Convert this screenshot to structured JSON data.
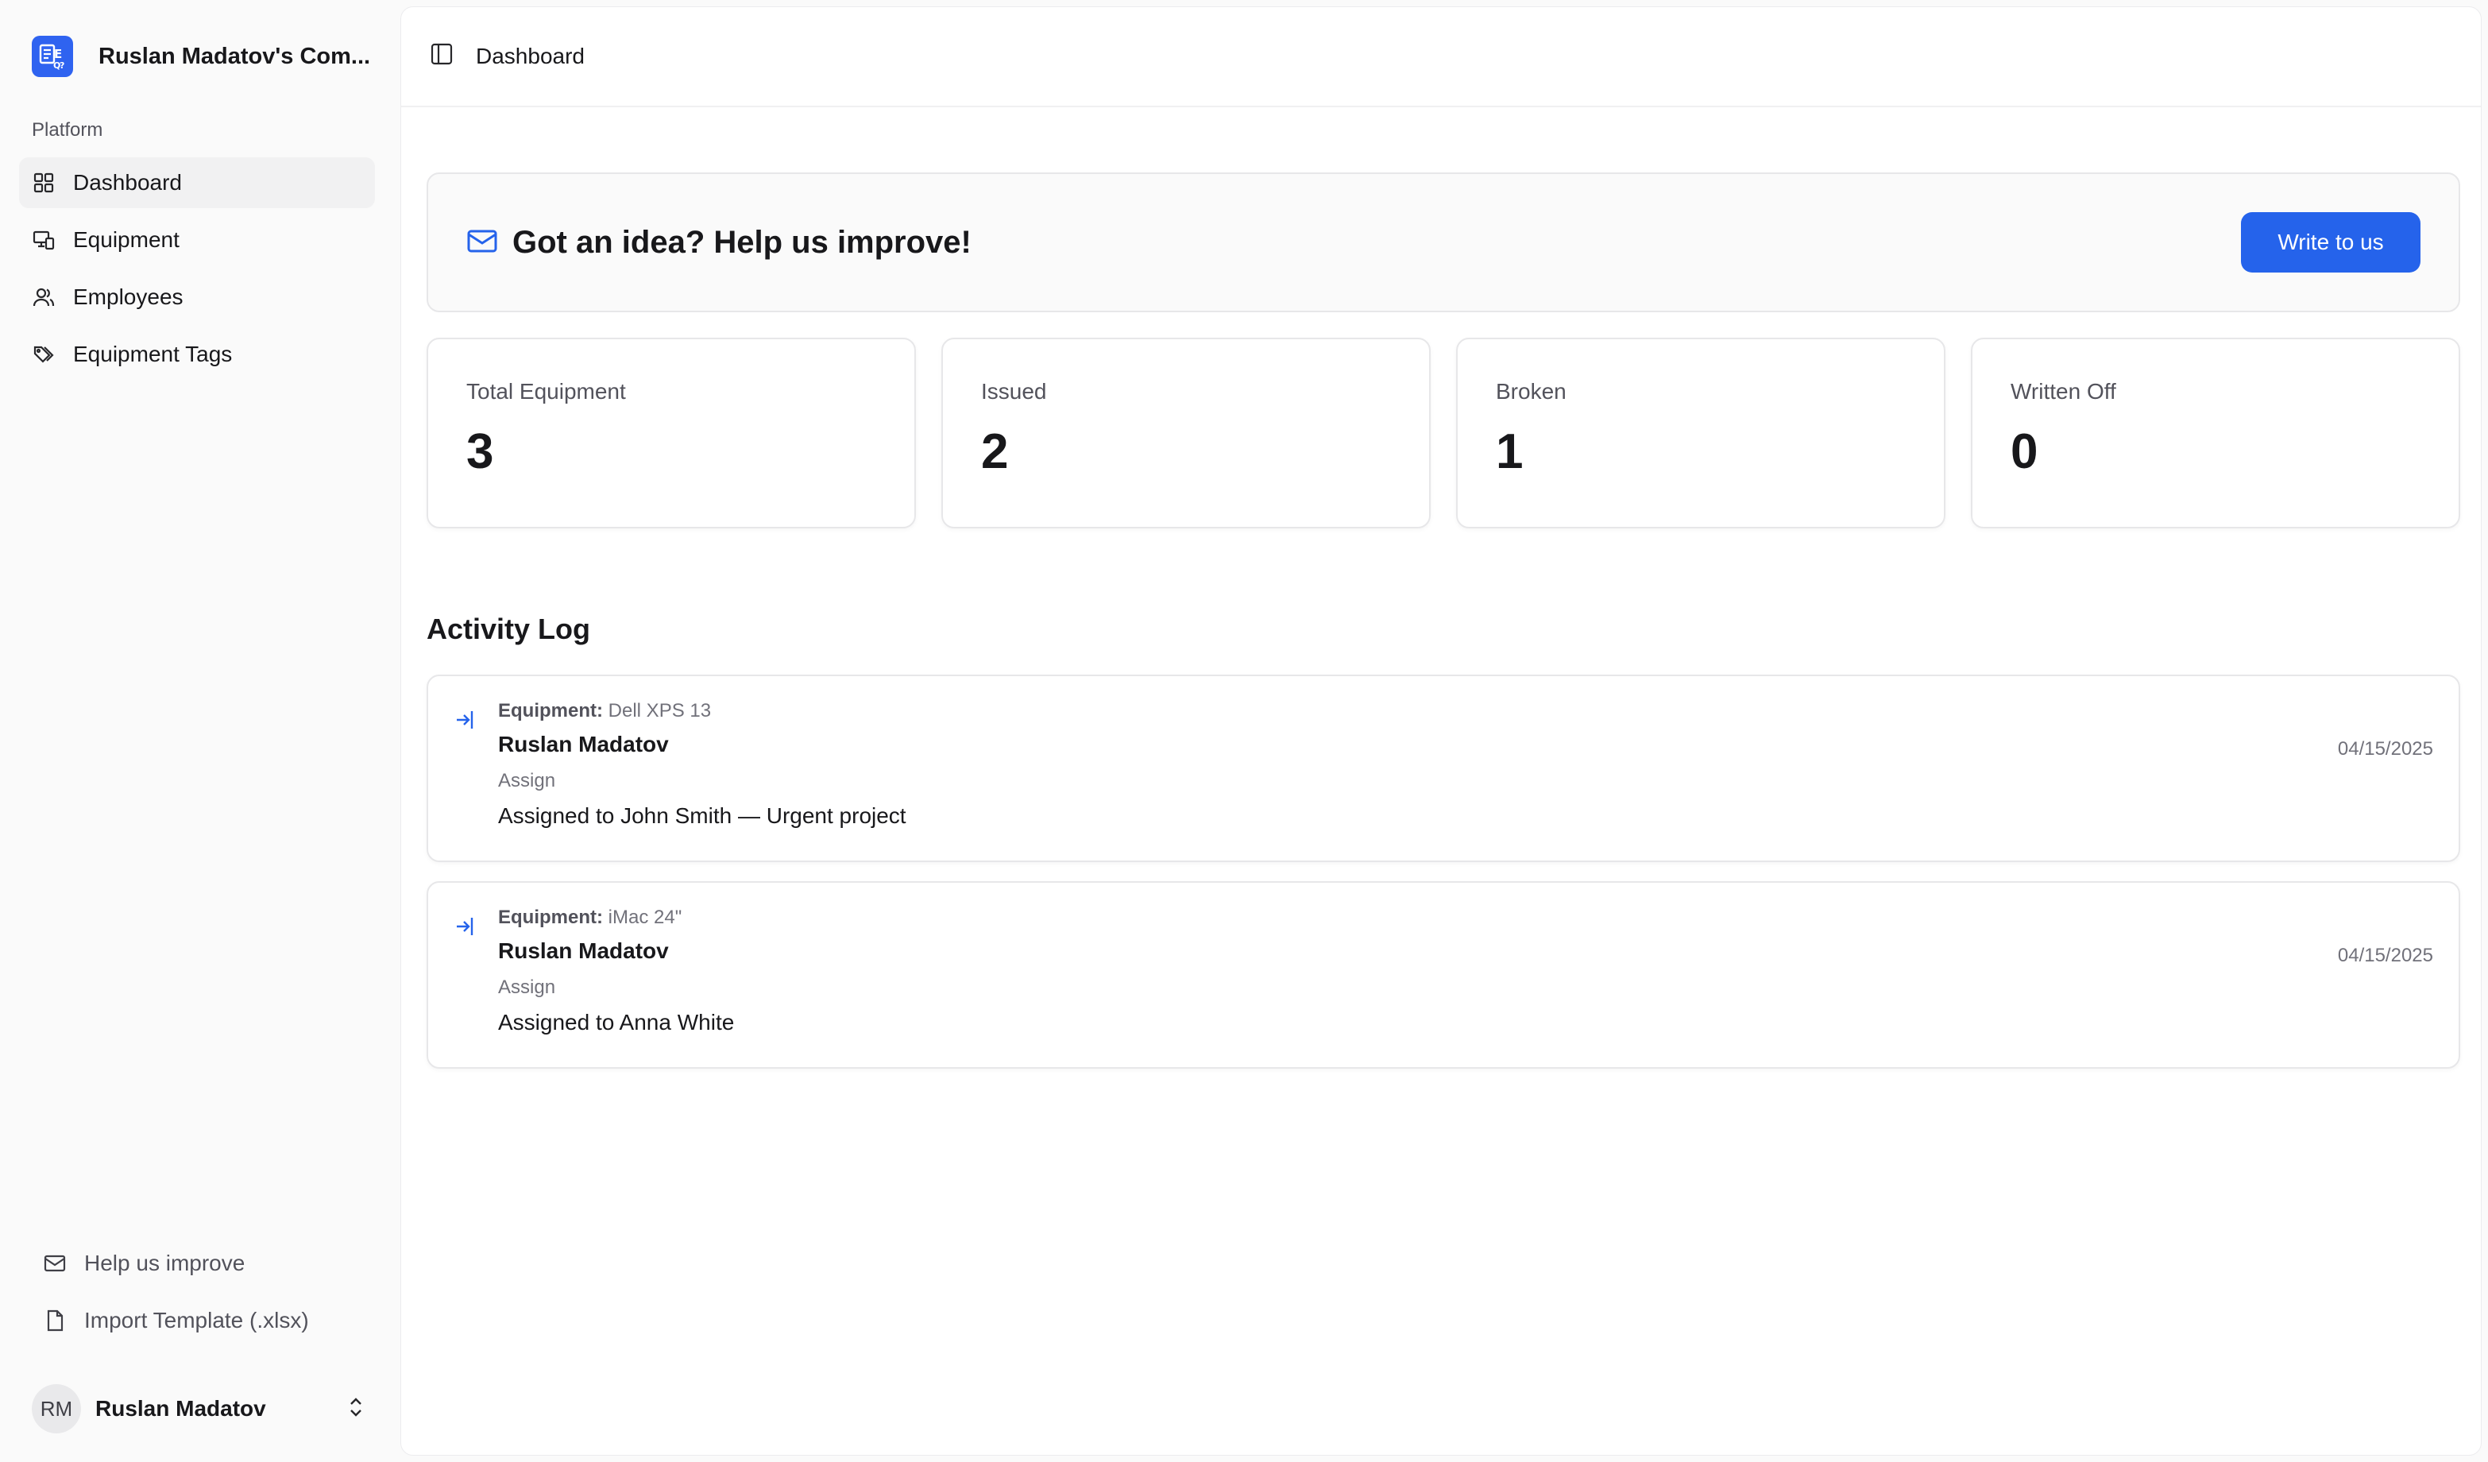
{
  "sidebar": {
    "company": "Ruslan Madatov's Com...",
    "section_label": "Platform",
    "items": [
      {
        "label": "Dashboard",
        "icon": "dashboard-icon"
      },
      {
        "label": "Equipment",
        "icon": "equipment-icon"
      },
      {
        "label": "Employees",
        "icon": "users-icon"
      },
      {
        "label": "Equipment Tags",
        "icon": "tags-icon"
      }
    ],
    "footer_links": [
      {
        "label": "Help us improve",
        "icon": "mail-icon"
      },
      {
        "label": "Import Template (.xlsx)",
        "icon": "file-icon"
      }
    ],
    "user": {
      "initials": "RM",
      "name": "Ruslan Madatov"
    }
  },
  "header": {
    "title": "Dashboard"
  },
  "banner": {
    "title": "Got an idea? Help us improve!",
    "button": "Write to us"
  },
  "stats": [
    {
      "label": "Total Equipment",
      "value": "3"
    },
    {
      "label": "Issued",
      "value": "2"
    },
    {
      "label": "Broken",
      "value": "1"
    },
    {
      "label": "Written Off",
      "value": "0"
    }
  ],
  "activity": {
    "title": "Activity Log",
    "equipment_prefix": "Equipment:",
    "entries": [
      {
        "equipment": "Dell XPS 13",
        "user": "Ruslan Madatov",
        "action": "Assign",
        "description": "Assigned to John Smith — Urgent project",
        "date": "04/15/2025"
      },
      {
        "equipment": "iMac 24\"",
        "user": "Ruslan Madatov",
        "action": "Assign",
        "description": "Assigned to Anna White",
        "date": "04/15/2025"
      }
    ]
  },
  "colors": {
    "accent": "#2563eb",
    "logo": "#2f63f0"
  }
}
